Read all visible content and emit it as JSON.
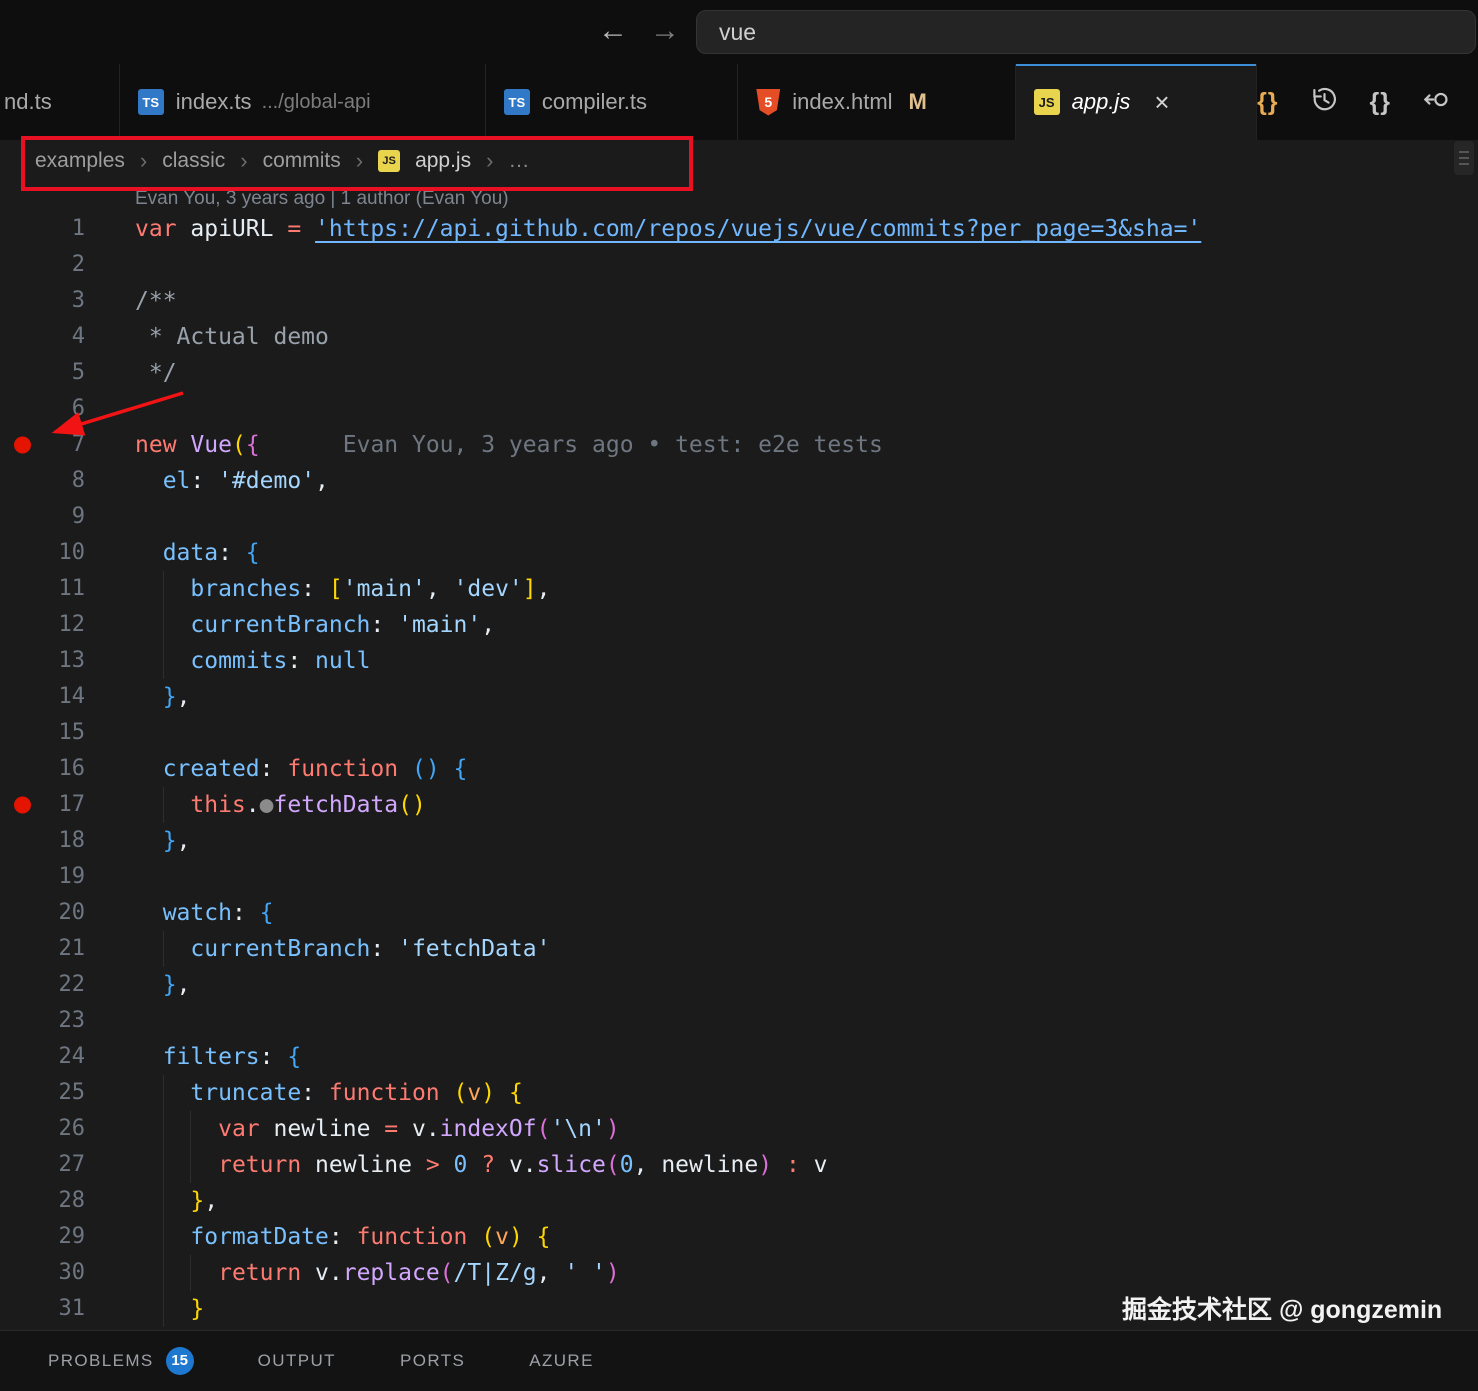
{
  "titlebar": {
    "search_value": "vue",
    "back": "←",
    "forward": "→"
  },
  "icons": {
    "ts": "TS",
    "js": "JS",
    "html5": "5",
    "braces": "{}",
    "close": "×",
    "chevron": "›",
    "more": "…"
  },
  "tabs": {
    "partial": {
      "label": "nd.ts"
    },
    "t1": {
      "label": "index.ts",
      "desc": ".../global-api"
    },
    "t2": {
      "label": "compiler.ts"
    },
    "t3": {
      "label": "index.html",
      "modified": "M"
    },
    "t4": {
      "label": "app.js"
    }
  },
  "breadcrumb": {
    "items": [
      "examples",
      "classic",
      "commits"
    ],
    "file": "app.js"
  },
  "blame_header": "Evan You, 3 years ago | 1 author (Evan You)",
  "editor": {
    "breakpoints": [
      7,
      17
    ],
    "lines": [
      [
        [
          "kw",
          "var"
        ],
        [
          "txt",
          " apiURL "
        ],
        [
          "op",
          "="
        ],
        [
          "txt",
          " "
        ],
        [
          "link",
          "'https://api.github.com/repos/vuejs/vue/commits?per_page=3&sha='"
        ]
      ],
      [],
      [
        [
          "cmt",
          "/**"
        ]
      ],
      [
        [
          "cmt",
          " * Actual demo"
        ]
      ],
      [
        [
          "cmt",
          " */"
        ]
      ],
      [],
      [
        [
          "kw",
          "new"
        ],
        [
          "txt",
          " "
        ],
        [
          "fn",
          "Vue"
        ],
        [
          "b1",
          "("
        ],
        [
          "b2",
          "{"
        ],
        [
          "blame",
          "      Evan You, 3 years ago • test: e2e tests"
        ]
      ],
      [
        [
          "txt",
          "  "
        ],
        [
          "prop",
          "el"
        ],
        [
          "txt",
          ": "
        ],
        [
          "str",
          "'#demo'"
        ],
        [
          "txt",
          ","
        ]
      ],
      [],
      [
        [
          "txt",
          "  "
        ],
        [
          "prop",
          "data"
        ],
        [
          "txt",
          ": "
        ],
        [
          "b3",
          "{"
        ]
      ],
      [
        [
          "txt",
          "    "
        ],
        [
          "prop",
          "branches"
        ],
        [
          "txt",
          ": "
        ],
        [
          "b1",
          "["
        ],
        [
          "str",
          "'main'"
        ],
        [
          "txt",
          ", "
        ],
        [
          "str",
          "'dev'"
        ],
        [
          "b1",
          "]"
        ],
        [
          "txt",
          ","
        ]
      ],
      [
        [
          "txt",
          "    "
        ],
        [
          "prop",
          "currentBranch"
        ],
        [
          "txt",
          ": "
        ],
        [
          "str",
          "'main'"
        ],
        [
          "txt",
          ","
        ]
      ],
      [
        [
          "txt",
          "    "
        ],
        [
          "prop",
          "commits"
        ],
        [
          "txt",
          ": "
        ],
        [
          "num",
          "null"
        ]
      ],
      [
        [
          "txt",
          "  "
        ],
        [
          "b3",
          "}"
        ],
        [
          "txt",
          ","
        ]
      ],
      [],
      [
        [
          "txt",
          "  "
        ],
        [
          "prop",
          "created"
        ],
        [
          "txt",
          ": "
        ],
        [
          "kw",
          "function"
        ],
        [
          "txt",
          " "
        ],
        [
          "b3",
          "()"
        ],
        [
          "txt",
          " "
        ],
        [
          "b3",
          "{"
        ]
      ],
      [
        [
          "txt",
          "    "
        ],
        [
          "kw",
          "this"
        ],
        [
          "txt",
          "."
        ],
        [
          "dot",
          "●"
        ],
        [
          "fn",
          "fetchData"
        ],
        [
          "b1",
          "()"
        ]
      ],
      [
        [
          "txt",
          "  "
        ],
        [
          "b3",
          "}"
        ],
        [
          "txt",
          ","
        ]
      ],
      [],
      [
        [
          "txt",
          "  "
        ],
        [
          "prop",
          "watch"
        ],
        [
          "txt",
          ": "
        ],
        [
          "b3",
          "{"
        ]
      ],
      [
        [
          "txt",
          "    "
        ],
        [
          "prop",
          "currentBranch"
        ],
        [
          "txt",
          ": "
        ],
        [
          "str",
          "'fetchData'"
        ]
      ],
      [
        [
          "txt",
          "  "
        ],
        [
          "b3",
          "}"
        ],
        [
          "txt",
          ","
        ]
      ],
      [],
      [
        [
          "txt",
          "  "
        ],
        [
          "prop",
          "filters"
        ],
        [
          "txt",
          ": "
        ],
        [
          "b3",
          "{"
        ]
      ],
      [
        [
          "txt",
          "    "
        ],
        [
          "prop",
          "truncate"
        ],
        [
          "txt",
          ": "
        ],
        [
          "kw",
          "function"
        ],
        [
          "txt",
          " "
        ],
        [
          "b1",
          "("
        ],
        [
          "param",
          "v"
        ],
        [
          "b1",
          ")"
        ],
        [
          "txt",
          " "
        ],
        [
          "b1",
          "{"
        ]
      ],
      [
        [
          "txt",
          "      "
        ],
        [
          "kw",
          "var"
        ],
        [
          "txt",
          " newline "
        ],
        [
          "op",
          "="
        ],
        [
          "txt",
          " v."
        ],
        [
          "fn",
          "indexOf"
        ],
        [
          "b2",
          "("
        ],
        [
          "str",
          "'\\n'"
        ],
        [
          "b2",
          ")"
        ]
      ],
      [
        [
          "txt",
          "      "
        ],
        [
          "kw",
          "return"
        ],
        [
          "txt",
          " newline "
        ],
        [
          "op",
          ">"
        ],
        [
          "txt",
          " "
        ],
        [
          "num",
          "0"
        ],
        [
          "txt",
          " "
        ],
        [
          "op",
          "?"
        ],
        [
          "txt",
          " v."
        ],
        [
          "fn",
          "slice"
        ],
        [
          "b2",
          "("
        ],
        [
          "num",
          "0"
        ],
        [
          "txt",
          ", newline"
        ],
        [
          "b2",
          ")"
        ],
        [
          "txt",
          " "
        ],
        [
          "op",
          ":"
        ],
        [
          "txt",
          " v"
        ]
      ],
      [
        [
          "txt",
          "    "
        ],
        [
          "b1",
          "}"
        ],
        [
          "txt",
          ","
        ]
      ],
      [
        [
          "txt",
          "    "
        ],
        [
          "prop",
          "formatDate"
        ],
        [
          "txt",
          ": "
        ],
        [
          "kw",
          "function"
        ],
        [
          "txt",
          " "
        ],
        [
          "b1",
          "("
        ],
        [
          "param",
          "v"
        ],
        [
          "b1",
          ")"
        ],
        [
          "txt",
          " "
        ],
        [
          "b1",
          "{"
        ]
      ],
      [
        [
          "txt",
          "      "
        ],
        [
          "kw",
          "return"
        ],
        [
          "txt",
          " v."
        ],
        [
          "fn",
          "replace"
        ],
        [
          "b2",
          "("
        ],
        [
          "re",
          "/T|Z/g"
        ],
        [
          "txt",
          ", "
        ],
        [
          "str",
          "' '"
        ],
        [
          "b2",
          ")"
        ]
      ],
      [
        [
          "txt",
          "    "
        ],
        [
          "b1",
          "}"
        ]
      ]
    ]
  },
  "panel": {
    "problems": "PROBLEMS",
    "problems_count": "15",
    "output": "OUTPUT",
    "ports": "PORTS",
    "azure": "AZURE"
  },
  "watermark": "掘金技术社区 @ gongzemin",
  "colors": {
    "accent": "#3d8fd9",
    "breakpoint": "#e51400",
    "annotation": "#e81123",
    "modified": "#e2c08d"
  }
}
